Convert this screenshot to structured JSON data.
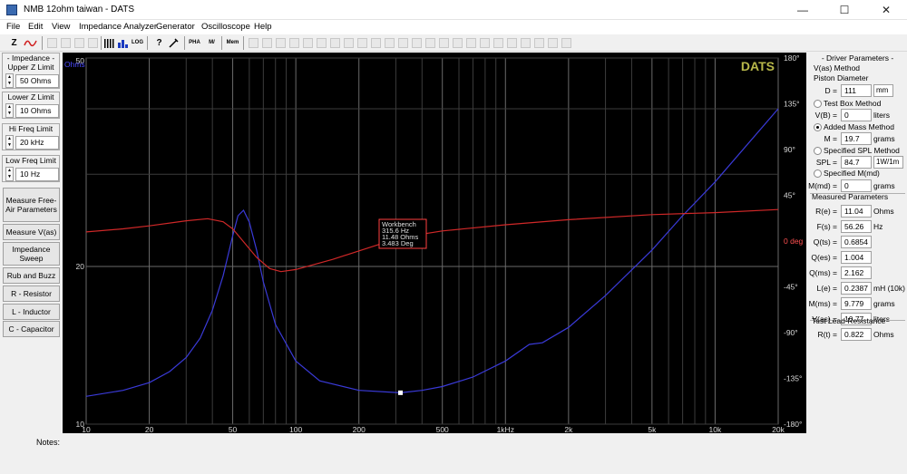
{
  "window": {
    "title": "NMB 12ohm taiwan - DATS",
    "minimize": "—",
    "maximize": "☐",
    "close": "✕"
  },
  "menu": [
    "File",
    "Edit",
    "View",
    "Impedance Analyzer",
    "Generator",
    "Oscilloscope",
    "Help"
  ],
  "toolbar": {
    "z": "Z",
    "pha": "PHA",
    "hz": "HZ",
    "log": "LOG",
    "help": "?",
    "pha2": "PHA",
    "mz": "M/",
    "mem": "Mem"
  },
  "left": {
    "group_title": "- Impedance -",
    "upper_label": "Upper Z Limit",
    "upper_value": "50 Ohms",
    "lower_label": "Lower Z Limit",
    "lower_value": "10 Ohms",
    "hi_label": "Hi Freq Limit",
    "hi_value": "20 kHz",
    "low_label": "Low Freq Limit",
    "low_value": "10 Hz",
    "buttons": [
      "Measure Free-Air Parameters",
      "Measure V(as)",
      "Impedance Sweep",
      "Rub and Buzz",
      "R - Resistor",
      "L - Inductor",
      "C - Capacitor"
    ]
  },
  "notes_label": "Notes:",
  "right": {
    "driver_title": "- Driver Parameters -",
    "vas_method": "V(as) Method",
    "piston": "Piston Diameter",
    "d_label": "D =",
    "d_value": "111",
    "d_unit": "mm",
    "test_box": "Test Box Method",
    "vb_label": "V(B) =",
    "vb_value": "0",
    "vb_unit": "liters",
    "added_mass": "Added Mass Method",
    "m_label": "M =",
    "m_value": "19.7",
    "m_unit": "grams",
    "spl_method": "Specified SPL Method",
    "spl_label": "SPL =",
    "spl_value": "84.7",
    "spl_unit": "1W/1m",
    "mmd_method": "Specified M(md)",
    "mmd_label": "M(md) =",
    "mmd_value": "0",
    "mmd_unit": "grams",
    "measured_title": "Measured Parameters",
    "measured": [
      {
        "label": "R(e) =",
        "value": "11.04",
        "unit": "Ohms"
      },
      {
        "label": "F(s) =",
        "value": "56.26",
        "unit": "Hz"
      },
      {
        "label": "Q(ts) =",
        "value": "0.6854",
        "unit": ""
      },
      {
        "label": "Q(es) =",
        "value": "1.004",
        "unit": ""
      },
      {
        "label": "Q(ms) =",
        "value": "2.162",
        "unit": ""
      },
      {
        "label": "L(e) =",
        "value": "0.2387",
        "unit": "mH (10k)"
      },
      {
        "label": "M(ms) =",
        "value": "9.779",
        "unit": "grams"
      },
      {
        "label": "V(as) =",
        "value": "10.77",
        "unit": "liters"
      }
    ],
    "lead_title": "Test Lead Resistance",
    "rt_label": "R(t) =",
    "rt_value": "0.822",
    "rt_unit": "Ohms"
  },
  "chart_data": {
    "type": "line",
    "brand": "DATS",
    "ylabel_left": "Ohms",
    "ylabel_right": "deg",
    "x_scale": "log",
    "xlim": [
      10,
      20000
    ],
    "ylim_left": [
      10,
      50
    ],
    "ylim_right": [
      -180,
      180
    ],
    "x_ticks": [
      {
        "v": 10,
        "label": "10"
      },
      {
        "v": 20,
        "label": "20"
      },
      {
        "v": 50,
        "label": "50"
      },
      {
        "v": 100,
        "label": "100"
      },
      {
        "v": 200,
        "label": "200"
      },
      {
        "v": 500,
        "label": "500"
      },
      {
        "v": 1000,
        "label": "1kHz"
      },
      {
        "v": 2000,
        "label": "2k"
      },
      {
        "v": 5000,
        "label": "5k"
      },
      {
        "v": 10000,
        "label": "10k"
      },
      {
        "v": 20000,
        "label": "20k"
      }
    ],
    "y_left_ticks": [
      {
        "v": 50,
        "label": "50"
      },
      {
        "v": 20,
        "label": "20"
      },
      {
        "v": 10,
        "label": "10"
      }
    ],
    "y_right_ticks": [
      {
        "v": 180,
        "label": "180°"
      },
      {
        "v": 135,
        "label": "135°"
      },
      {
        "v": 90,
        "label": "90°"
      },
      {
        "v": 45,
        "label": "45°"
      },
      {
        "v": 0,
        "label": "0 deg"
      },
      {
        "v": -45,
        "label": "-45°"
      },
      {
        "v": -90,
        "label": "-90°"
      },
      {
        "v": -135,
        "label": "-135°"
      },
      {
        "v": -180,
        "label": "-180°"
      }
    ],
    "grid": true,
    "series": [
      {
        "name": "Impedance",
        "color": "#3a3ad8",
        "axis": "left",
        "x": [
          10,
          15,
          20,
          25,
          30,
          35,
          40,
          45,
          50,
          53,
          56.3,
          60,
          65,
          70,
          80,
          100,
          130,
          200,
          315.6,
          400,
          500,
          700,
          1000,
          1300,
          1500,
          2000,
          3000,
          5000,
          7000,
          10000,
          20000
        ],
        "y": [
          11.3,
          11.6,
          12.0,
          12.6,
          13.4,
          14.6,
          16.5,
          19.2,
          22.9,
          25.0,
          25.6,
          24.3,
          21.5,
          18.7,
          15.5,
          13.2,
          12.1,
          11.6,
          11.48,
          11.6,
          11.8,
          12.3,
          13.2,
          14.2,
          14.3,
          15.3,
          17.6,
          21.5,
          25.0,
          29.0,
          40.0
        ]
      },
      {
        "name": "Phase",
        "color": "#d02828",
        "axis": "right",
        "x": [
          10,
          15,
          20,
          30,
          38,
          45,
          50,
          56,
          65,
          75,
          85,
          100,
          150,
          315.6,
          500,
          1000,
          2000,
          5000,
          10000,
          20000
        ],
        "y": [
          9,
          12,
          15,
          20,
          22,
          19,
          12,
          0,
          -16,
          -27,
          -30,
          -28,
          -18,
          3.5,
          10,
          16,
          21,
          26,
          28,
          31
        ]
      }
    ],
    "marker": {
      "x": 315.6,
      "y": 11.48,
      "title": "Workbench",
      "lines": [
        "315.6 Hz",
        "11.48 Ohms",
        "3.483 Deg"
      ]
    }
  }
}
